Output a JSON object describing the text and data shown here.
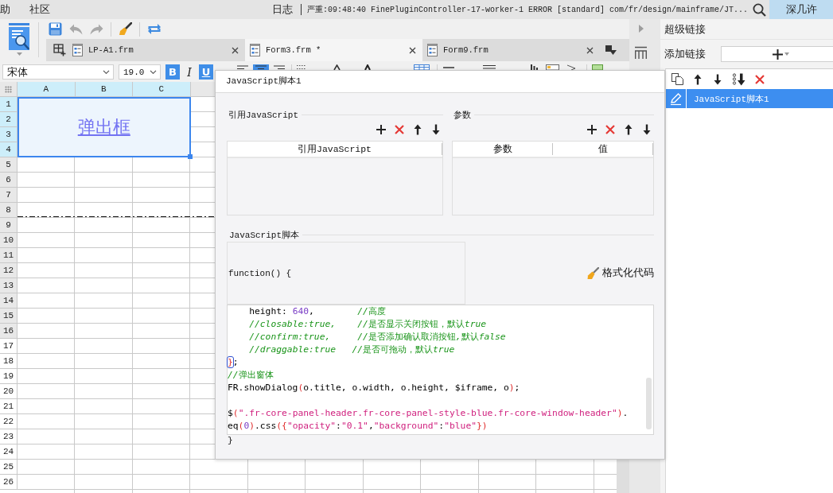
{
  "menubar": {
    "menus": [
      "助",
      "社区"
    ],
    "log_label": "日志",
    "log_message": "严重:09:48:40 FinePluginController-17-worker-1 ERROR [standard] com/fr/design/mainframe/JT...",
    "user": "深几许"
  },
  "toolbar": {
    "groups": [
      [
        {
          "kind": "save",
          "disabled": false
        },
        {
          "kind": "undo",
          "disabled": true
        },
        {
          "kind": "redo",
          "disabled": true
        }
      ],
      [
        {
          "kind": "brush",
          "disabled": false
        }
      ],
      [
        {
          "kind": "refresh",
          "disabled": false
        }
      ]
    ]
  },
  "tabs": [
    {
      "label": "LP-A1.frm",
      "selected": false
    },
    {
      "label": "Form3.frm *",
      "selected": true
    },
    {
      "label": "Form9.frm",
      "selected": false
    }
  ],
  "format_bar": {
    "font": "宋体",
    "size": "19.0",
    "styles": [
      {
        "kind": "bold",
        "label": "B",
        "selected": true
      },
      {
        "kind": "italic",
        "label": "I",
        "selected": false
      },
      {
        "kind": "underline",
        "label": "U",
        "selected": true
      }
    ],
    "alignment": [
      {
        "kind": "left",
        "selected": false
      },
      {
        "kind": "center",
        "selected": true
      },
      {
        "kind": "right",
        "selected": false
      }
    ]
  },
  "sheet": {
    "columns": [
      {
        "label": "A",
        "selected": true
      },
      {
        "label": "B",
        "selected": true
      },
      {
        "label": "C",
        "selected": true
      }
    ],
    "rows": [
      {
        "label": "1",
        "selected": true,
        "shaded": true
      },
      {
        "label": "2",
        "selected": true,
        "shaded": true
      },
      {
        "label": "3",
        "selected": true,
        "shaded": true
      },
      {
        "label": "4",
        "selected": true,
        "shaded": true
      },
      {
        "label": "5",
        "selected": false,
        "shaded": true
      },
      {
        "label": "6",
        "selected": false,
        "shaded": true
      },
      {
        "label": "7",
        "selected": false,
        "shaded": true
      },
      {
        "label": "8",
        "selected": false,
        "shaded": true
      },
      {
        "label": "9",
        "selected": false,
        "shaded": true
      },
      {
        "label": "10",
        "selected": false,
        "shaded": true
      },
      {
        "label": "11",
        "selected": false,
        "shaded": true
      },
      {
        "label": "12",
        "selected": false,
        "shaded": true
      },
      {
        "label": "13",
        "selected": false,
        "shaded": true
      },
      {
        "label": "14",
        "selected": false,
        "shaded": true
      },
      {
        "label": "15",
        "selected": false,
        "shaded": true
      },
      {
        "label": "16",
        "selected": false,
        "shaded": true
      },
      {
        "label": "17",
        "selected": false,
        "shaded": false
      },
      {
        "label": "18",
        "selected": false,
        "shaded": false
      },
      {
        "label": "19",
        "selected": false,
        "shaded": false
      },
      {
        "label": "20",
        "selected": false,
        "shaded": false
      },
      {
        "label": "21",
        "selected": false,
        "shaded": false
      },
      {
        "label": "22",
        "selected": false,
        "shaded": false
      },
      {
        "label": "23",
        "selected": false,
        "shaded": false
      },
      {
        "label": "24",
        "selected": false,
        "shaded": false
      },
      {
        "label": "25",
        "selected": false,
        "shaded": false
      },
      {
        "label": "26",
        "selected": false,
        "shaded": false
      }
    ],
    "cell": {
      "text": "弹出框",
      "selected": true
    }
  },
  "link_panel": {
    "title": "超级链接",
    "add_label": "添加链接",
    "links": [
      {
        "label": "JavaScript脚本1",
        "selected": true
      }
    ]
  },
  "dialog": {
    "title": "JavaScript脚本1",
    "imports": {
      "title": "引用JavaScript",
      "columns": [
        "引用JavaScript"
      ]
    },
    "params": {
      "title": "参数",
      "columns": [
        "参数",
        "值"
      ]
    },
    "script": {
      "title": "JavaScript脚本",
      "header": "function() {",
      "format_button": "格式化代码",
      "lines": [
        {
          "kind": "code",
          "tokens": [
            {
              "text": "    height: ",
              "kind": "plain"
            },
            {
              "text": "640",
              "kind": "number"
            },
            {
              "text": ",        ",
              "kind": "plain"
            },
            {
              "text": "//高度",
              "kind": "comment"
            }
          ]
        },
        {
          "kind": "code",
          "tokens": [
            {
              "text": "    //closable:true,    //是否显示关闭按钮，默认true",
              "kind": "comment"
            }
          ]
        },
        {
          "kind": "code",
          "tokens": [
            {
              "text": "    //confirm:true,     //是否添加确认取消按钮,默认false",
              "kind": "comment"
            }
          ]
        },
        {
          "kind": "code",
          "tokens": [
            {
              "text": "    //draggable:true   //是否可拖动，默认true",
              "kind": "comment"
            }
          ]
        },
        {
          "kind": "code",
          "tokens": [
            {
              "text": "}",
              "kind": "match"
            },
            {
              "text": ";",
              "kind": "plain"
            }
          ]
        },
        {
          "kind": "code",
          "tokens": [
            {
              "text": "//弹出窗体",
              "kind": "comment"
            }
          ]
        },
        {
          "kind": "code",
          "tokens": [
            {
              "text": "FR.showDialog",
              "kind": "plain"
            },
            {
              "text": "(",
              "kind": "paren"
            },
            {
              "text": "o.title, o.width, o.height, $iframe, o",
              "kind": "plain"
            },
            {
              "text": ")",
              "kind": "paren"
            },
            {
              "text": ";",
              "kind": "plain"
            }
          ]
        },
        {
          "kind": "blank"
        },
        {
          "kind": "code",
          "tokens": [
            {
              "text": "$",
              "kind": "plain"
            },
            {
              "text": "(",
              "kind": "paren"
            },
            {
              "text": "\".fr-core-panel-header.fr-core-panel-style-blue.fr-core-window-header\"",
              "kind": "string"
            },
            {
              "text": ")",
              "kind": "paren"
            },
            {
              "text": ".",
              "kind": "plain"
            }
          ]
        },
        {
          "kind": "code",
          "tokens": [
            {
              "text": "eq",
              "kind": "plain"
            },
            {
              "text": "(",
              "kind": "paren"
            },
            {
              "text": "0",
              "kind": "number"
            },
            {
              "text": ")",
              "kind": "paren"
            },
            {
              "text": ".css",
              "kind": "plain"
            },
            {
              "text": "({",
              "kind": "paren"
            },
            {
              "text": "\"opacity\"",
              "kind": "string"
            },
            {
              "text": ":",
              "kind": "plain"
            },
            {
              "text": "\"0.1\"",
              "kind": "string"
            },
            {
              "text": ",",
              "kind": "plain"
            },
            {
              "text": "\"background\"",
              "kind": "string"
            },
            {
              "text": ":",
              "kind": "plain"
            },
            {
              "text": "\"blue\"",
              "kind": "string"
            },
            {
              "text": "})",
              "kind": "paren"
            }
          ]
        }
      ],
      "footer": "}"
    }
  }
}
